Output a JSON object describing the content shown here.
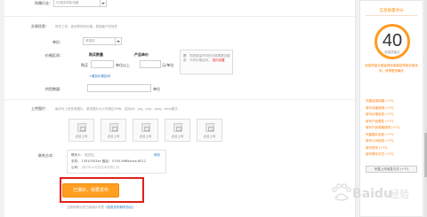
{
  "form": {
    "top_label": "所属行业：",
    "top_select": "可选择机械/设备",
    "trade_info_label": "交易信息：",
    "trade_info_tip": "所在工作、真实联系的价格，提高客户的信任",
    "unit_label": "单位：",
    "unit_select": "请选择",
    "price_label": "价格区间：",
    "qty_header": "购买数量",
    "price_header": "产品单价",
    "buy_prefix": "购买",
    "unit_suffix": "单位以上",
    "yuan_suffix": "元/单位",
    "add_price_link": "+增加价格区间",
    "price_tip_label": "提示",
    "price_tip_text": "同类数量不同的价格需要设置不同价格区间，",
    "price_tip_link": "如何设置",
    "supply_label": "供货数量：",
    "supply_suffix": "单位",
    "image_label": "上传图片：",
    "image_tip": "每次可上传多张图片，单张图片大小不超过3MB，支持gif，jpg，png，jpeg，bmp格式",
    "upload_caption": "点此上传",
    "contact_label": "联系方式：",
    "contact_lines": [
      {
        "key": "联系人：",
        "val": "林先生",
        "link": "修改"
      },
      {
        "key": "手机：",
        "val": "13510303xx  固话：  0755-6989xxxx-6012",
        "link": ""
      },
      {
        "key": "公司：",
        "val": "深圳市xx信息技术有限公司",
        "link": ""
      }
    ]
  },
  "submit": {
    "label": "已填好，我要发布",
    "footnote_prefix": "注册即表示您已阅读并同意",
    "footnote_link": "《信息发布服务协议》"
  },
  "sidebar": {
    "title": "信息质量评分",
    "score": "40",
    "score_caption": "信息质量分",
    "desc": "信息质量分越高的信息越容易被买家找到，获得更多曝光",
    "items": [
      "完善信息标题 (+??)",
      "填写详细说明 (+??)",
      "填写价格信息 (+??)",
      "填写产品属性 (+??)",
      "填写产品规格说明 (+??)",
      "完善图片信息 (+??)",
      "填写公司信息 (+??)",
      "填写型号 (+??)",
      "填写联系方式 (+??)"
    ],
    "more_button": "完善上传信息方法 (+??)"
  },
  "watermark": "Baidu 经验",
  "colors": {
    "accent": "#ff9f22",
    "score_ring": "#ff9a1f",
    "highlight_frame": "#e0201a",
    "link": "#2b77c5"
  }
}
